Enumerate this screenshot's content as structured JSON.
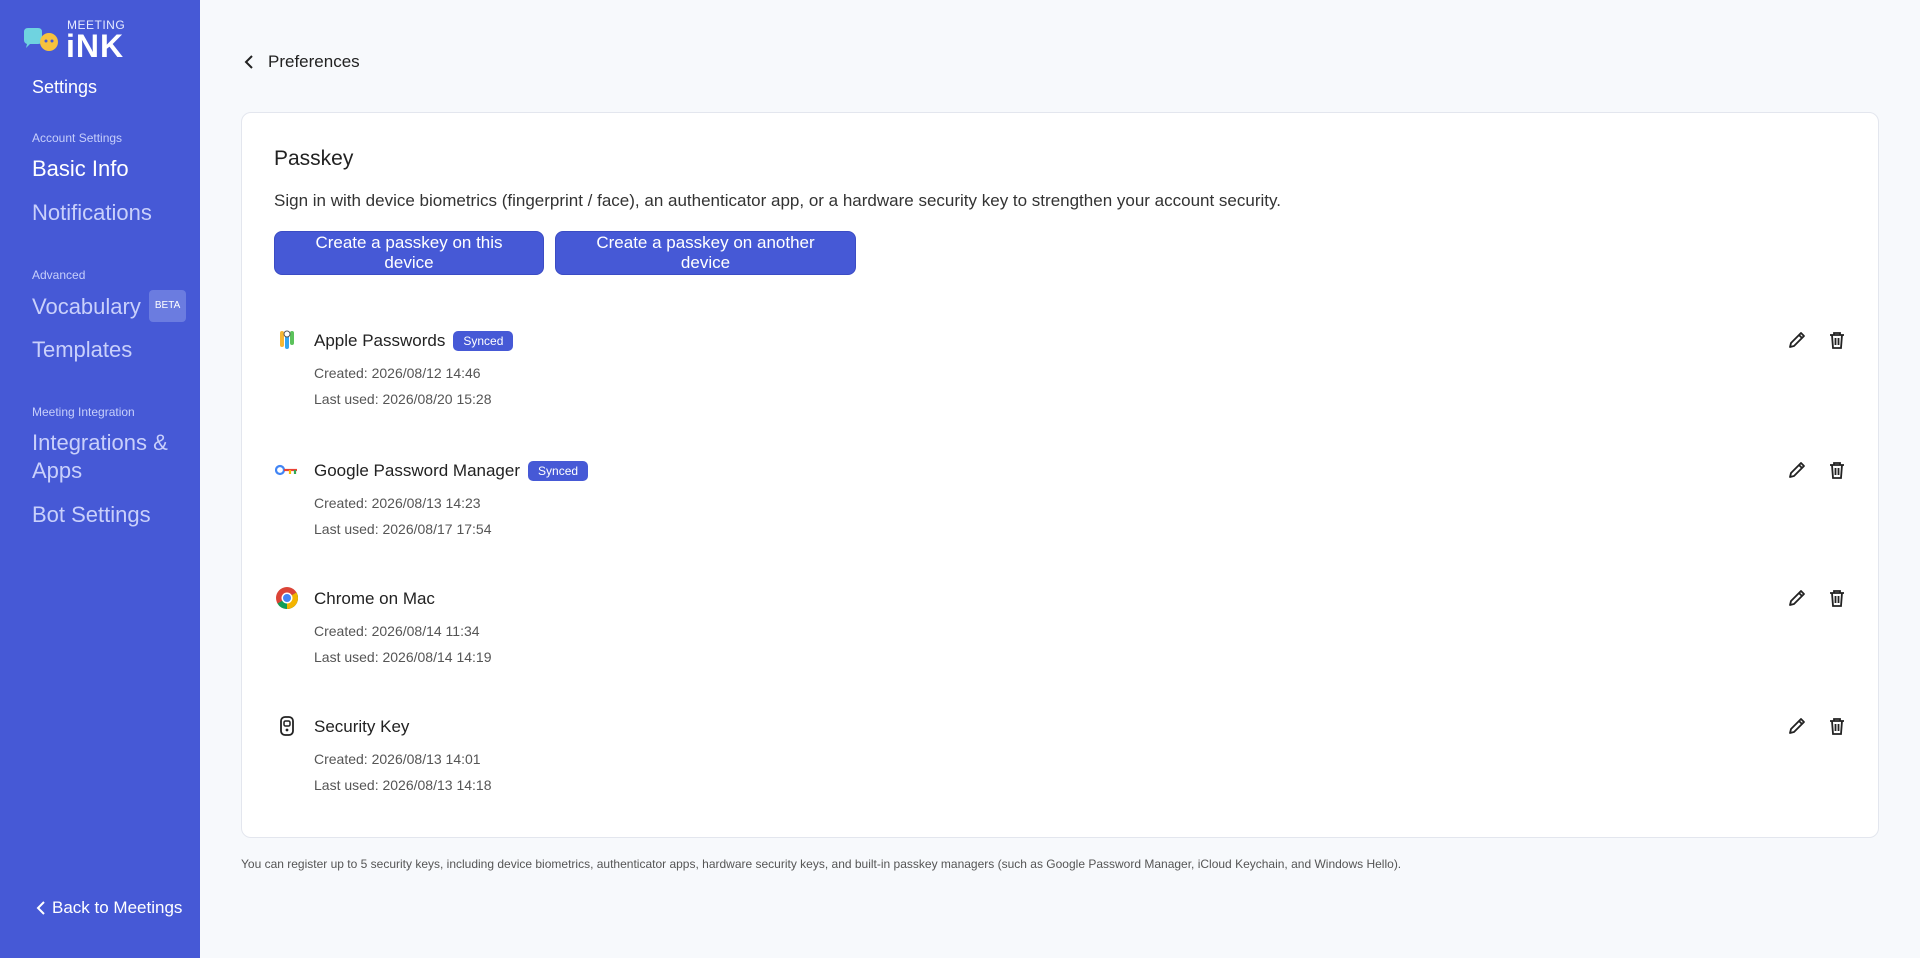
{
  "sidebar": {
    "logo_top": "MEETING",
    "logo_main": "iNK",
    "title": "Settings",
    "sections": [
      {
        "label": "Account Settings"
      },
      {
        "label": "Advanced"
      },
      {
        "label": "Meeting Integration"
      }
    ],
    "items": [
      {
        "label": "Basic Info"
      },
      {
        "label": "Notifications"
      },
      {
        "label": "Vocabulary",
        "badge": "BETA"
      },
      {
        "label": "Templates"
      },
      {
        "label": "Integrations & Apps"
      },
      {
        "label": "Bot Settings"
      }
    ],
    "back_label": "Back to Meetings"
  },
  "header": {
    "breadcrumb": "Preferences"
  },
  "card": {
    "title": "Passkey",
    "description": "Sign in with device biometrics (fingerprint / face), an authenticator app, or a hardware security key to strengthen your account security.",
    "create_this_label": "Create a passkey on this device",
    "create_another_label": "Create a passkey on another device",
    "passkeys": [
      {
        "name": "Apple Passwords",
        "badge": "Synced",
        "created": "Created: 2026/08/12 14:46",
        "last_used": "Last used: 2026/08/20 15:28",
        "icon": "apple-passwords-icon"
      },
      {
        "name": "Google Password Manager",
        "badge": "Synced",
        "created": "Created: 2026/08/13 14:23",
        "last_used": "Last used: 2026/08/17 17:54",
        "icon": "google-password-manager-icon"
      },
      {
        "name": "Chrome on Mac",
        "created": "Created: 2026/08/14 11:34",
        "last_used": "Last used: 2026/08/14 14:19",
        "icon": "chrome-icon"
      },
      {
        "name": "Security Key",
        "created": "Created: 2026/08/13 14:01",
        "last_used": "Last used: 2026/08/13 14:18",
        "icon": "security-key-icon"
      }
    ]
  },
  "footnote": "You can register up to 5 security keys, including device biometrics, authenticator apps, hardware security keys, and built-in passkey managers (such as Google Password Manager, iCloud Keychain, and Windows Hello).",
  "colors": {
    "accent": "#4659d6",
    "background": "#f7f9fc"
  }
}
